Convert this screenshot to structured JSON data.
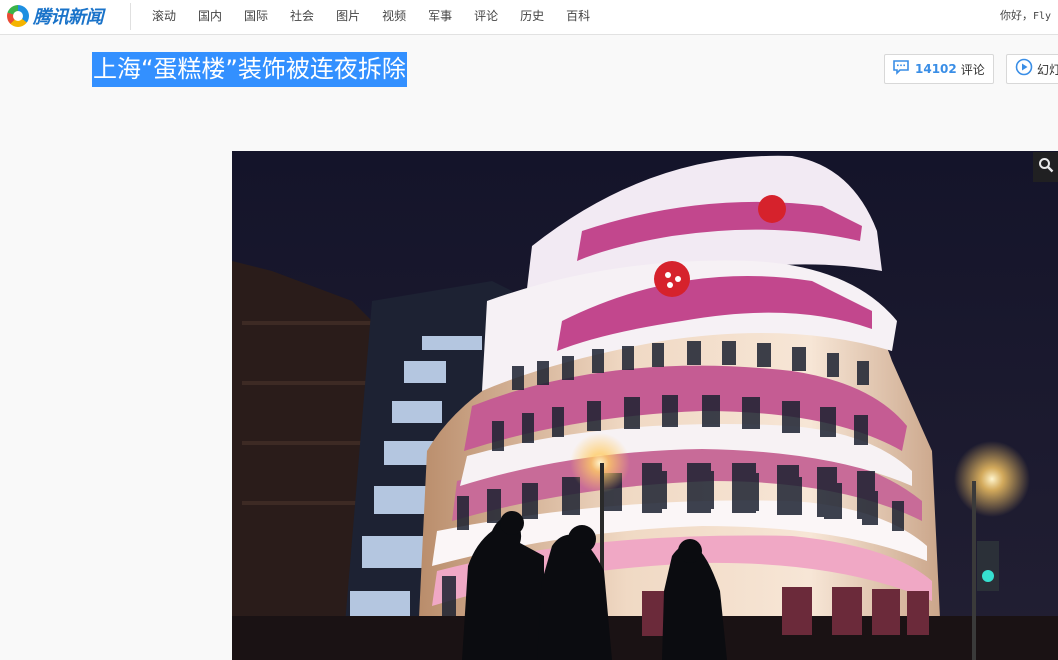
{
  "site": {
    "logo_text": "腾讯新闻"
  },
  "nav": {
    "items": [
      "滚动",
      "国内",
      "国际",
      "社会",
      "图片",
      "视频",
      "军事",
      "评论",
      "历史",
      "百科"
    ]
  },
  "user": {
    "greeting": "你好，",
    "name": "Fly"
  },
  "article": {
    "title": "上海“蛋糕楼”装饰被连夜拆除",
    "comment_count": "14102",
    "comment_label": "评论",
    "slideshow_label": "幻灯"
  },
  "colors": {
    "brand": "#1a73c9",
    "selection": "#3390ff",
    "comment_count": "#3a8ee6"
  }
}
